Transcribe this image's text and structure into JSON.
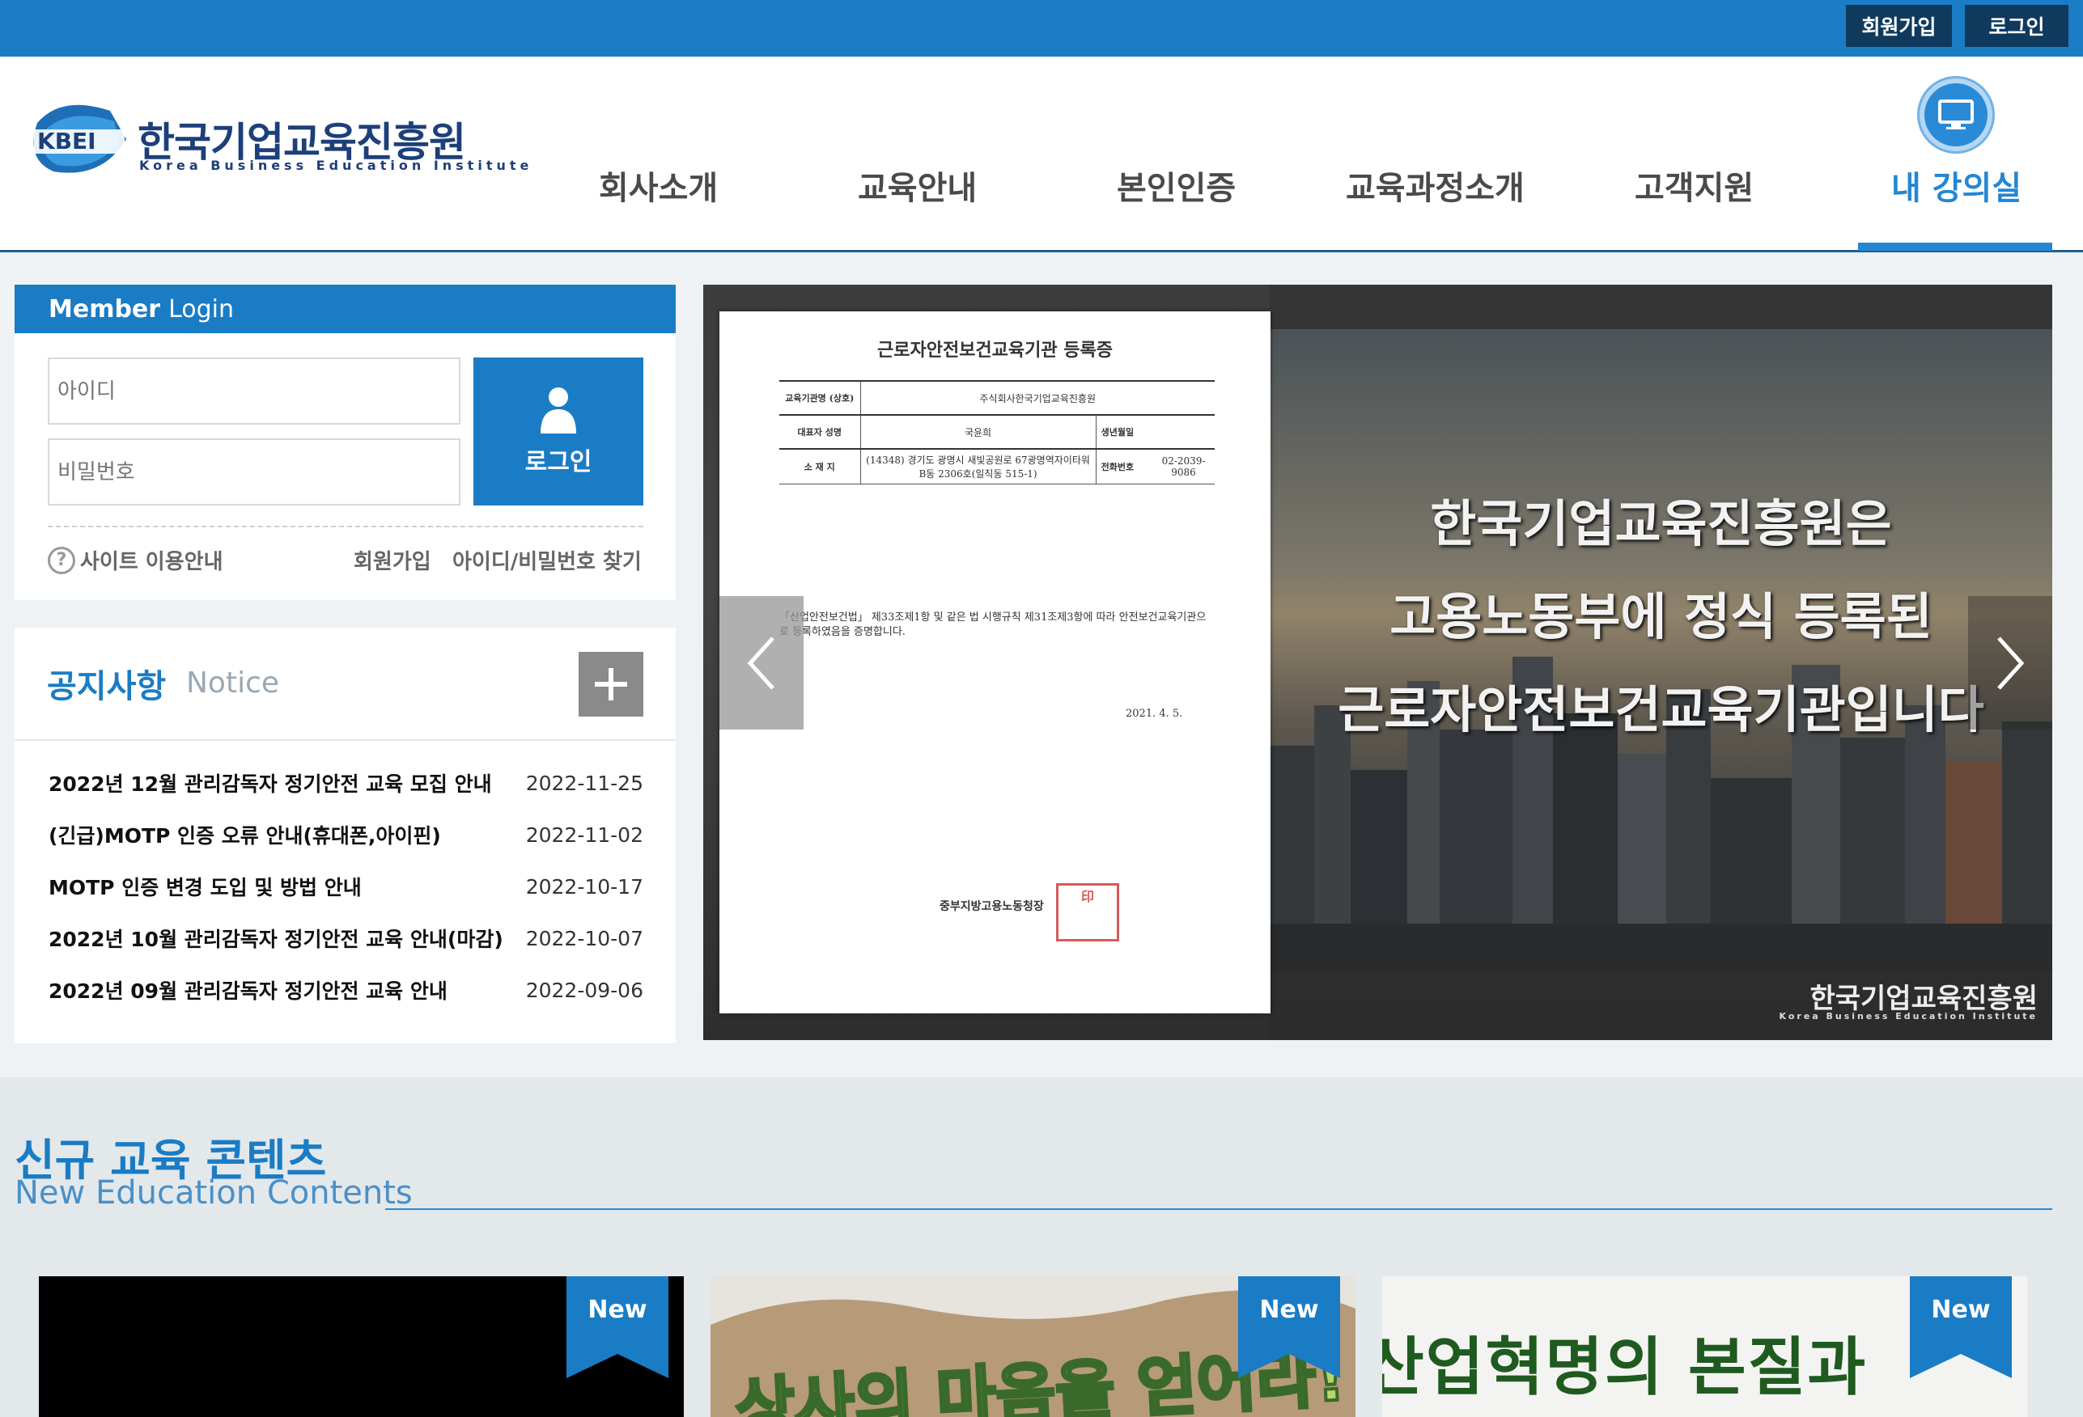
{
  "topbar": {
    "join": "회원가입",
    "login": "로그인"
  },
  "logo": {
    "ko": "한국기업교육진흥원",
    "en": "Korea Business Education Institute",
    "mark": "KBEI"
  },
  "nav": [
    "회사소개",
    "교육안내",
    "본인인증",
    "교육과정소개",
    "고객지원",
    "내 강의실"
  ],
  "login": {
    "title_bold": "Member",
    "title_rest": "Login",
    "id_placeholder": "아이디",
    "pw_placeholder": "비밀번호",
    "button": "로그인",
    "site_guide": "사이트 이용안내",
    "join": "회원가입",
    "find": "아이디/비밀번호 찾기"
  },
  "notice": {
    "title": "공지사항",
    "subtitle": "Notice",
    "items": [
      {
        "title": "2022년 12월 관리감독자 정기안전 교육 모집 안내",
        "date": "2022-11-25"
      },
      {
        "title": "(긴급)MOTP 인증 오류 안내(휴대폰,아이핀)",
        "date": "2022-11-02"
      },
      {
        "title": "MOTP 인증 변경 도입 및 방법 안내",
        "date": "2022-10-17"
      },
      {
        "title": "2022년 10월 관리감독자 정기안전 교육 안내(마감)",
        "date": "2022-10-07"
      },
      {
        "title": "2022년 09월 관리감독자 정기안전 교육 안내",
        "date": "2022-09-06"
      }
    ]
  },
  "banner": {
    "lines": [
      "한국기업교육진흥원은",
      "고용노동부에 정식 등록된",
      "근로자안전보건교육기관입니다"
    ],
    "footer_ko": "한국기업교육진흥원",
    "footer_en": "Korea Business Education Institute",
    "certificate": {
      "title": "근로자안전보건교육기관 등록증",
      "rows": [
        {
          "key": "교육기관명 (상호)",
          "value": "주식회사한국기업교육진흥원"
        },
        {
          "key": "대표자 성명",
          "value": "국윤희",
          "key2": "생년월일"
        },
        {
          "key": "소 재 지",
          "value": "(14348) 경기도 광명시 새빛공원로 67광명역자이타워 B동 2306호(일직동 515-1)",
          "key2": "전화번호",
          "value2": "02-2039-9086"
        }
      ],
      "body": "「산업안전보건법」 제33조제1항 및 같은 법 시행규칙 제31조제3항에 따라 안전보건교육기관으로 등록하였음을 증명합니다.",
      "date": "2021. 4. 5.",
      "issuer": "중부지방고용노동청장"
    }
  },
  "contents": {
    "title": "신규 교육 콘텐츠",
    "subtitle": "New Education Contents",
    "badge": "New",
    "cards": [
      {
        "text": ""
      },
      {
        "text": "상사의 마음을 얻어라!"
      },
      {
        "text": "산업혁명의 본질과"
      }
    ]
  },
  "colors": {
    "primary": "#1a7cc4",
    "dark": "#0f3a5e",
    "accent": "#2387d4"
  }
}
